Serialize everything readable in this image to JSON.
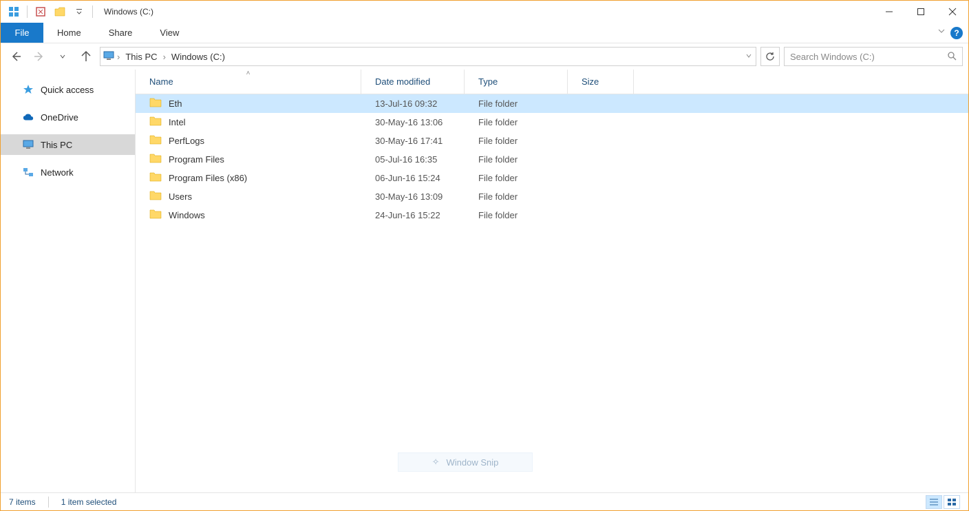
{
  "window": {
    "title": "Windows (C:)"
  },
  "ribbon": {
    "file": "File",
    "tabs": [
      "Home",
      "Share",
      "View"
    ]
  },
  "breadcrumb": {
    "items": [
      "This PC",
      "Windows (C:)"
    ]
  },
  "search": {
    "placeholder": "Search Windows (C:)"
  },
  "sidebar": {
    "items": [
      {
        "label": "Quick access",
        "icon": "star"
      },
      {
        "label": "OneDrive",
        "icon": "cloud"
      },
      {
        "label": "This PC",
        "icon": "monitor",
        "selected": true
      },
      {
        "label": "Network",
        "icon": "network"
      }
    ]
  },
  "columns": {
    "name": "Name",
    "date": "Date modified",
    "type": "Type",
    "size": "Size"
  },
  "rows": [
    {
      "name": "Eth",
      "date": "13-Jul-16 09:32",
      "type": "File folder",
      "selected": true
    },
    {
      "name": "Intel",
      "date": "30-May-16 13:06",
      "type": "File folder"
    },
    {
      "name": "PerfLogs",
      "date": "30-May-16 17:41",
      "type": "File folder"
    },
    {
      "name": "Program Files",
      "date": "05-Jul-16 16:35",
      "type": "File folder"
    },
    {
      "name": "Program Files (x86)",
      "date": "06-Jun-16 15:24",
      "type": "File folder"
    },
    {
      "name": "Users",
      "date": "30-May-16 13:09",
      "type": "File folder"
    },
    {
      "name": "Windows",
      "date": "24-Jun-16 15:22",
      "type": "File folder"
    }
  ],
  "status": {
    "count": "7 items",
    "selection": "1 item selected"
  },
  "snip": {
    "label": "Window Snip"
  }
}
